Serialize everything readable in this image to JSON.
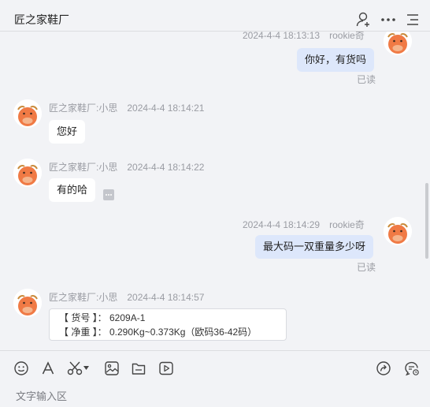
{
  "header": {
    "title": "匠之家鞋厂",
    "icons": [
      "add-user-icon",
      "more-icon",
      "menu-icon"
    ]
  },
  "messages": [
    {
      "direction": "out",
      "time": "2024-4-4 18:13:13",
      "sender": "rookie奇",
      "text": "你好，有货吗",
      "status": "已读"
    },
    {
      "direction": "in",
      "time": "2024-4-4 18:14:21",
      "sender": "匠之家鞋厂:小思",
      "text": "您好"
    },
    {
      "direction": "in",
      "time": "2024-4-4 18:14:22",
      "sender": "匠之家鞋厂:小思",
      "text": "有的哈"
    },
    {
      "direction": "out",
      "time": "2024-4-4 18:14:29",
      "sender": "rookie奇",
      "text": "最大码一双重量多少呀",
      "status": "已读"
    },
    {
      "direction": "in",
      "time": "2024-4-4 18:14:57",
      "sender": "匠之家鞋厂:小思",
      "card": [
        "【 货号 】：  6209A-1",
        "【 净重 】：  0.290Kg~0.373Kg（欧码36-42码）"
      ]
    }
  ],
  "input": {
    "placeholder": "文字输入区",
    "tools": [
      "emoji-icon",
      "font-icon",
      "scissors-icon",
      "image-icon",
      "folder-icon",
      "video-icon",
      "share-icon",
      "chat-history-icon"
    ]
  },
  "colors": {
    "background": "#f2f3f6",
    "outgoing_bubble": "#dde7fb",
    "incoming_bubble": "#ffffff",
    "avatar_orange": "#f07a45"
  }
}
